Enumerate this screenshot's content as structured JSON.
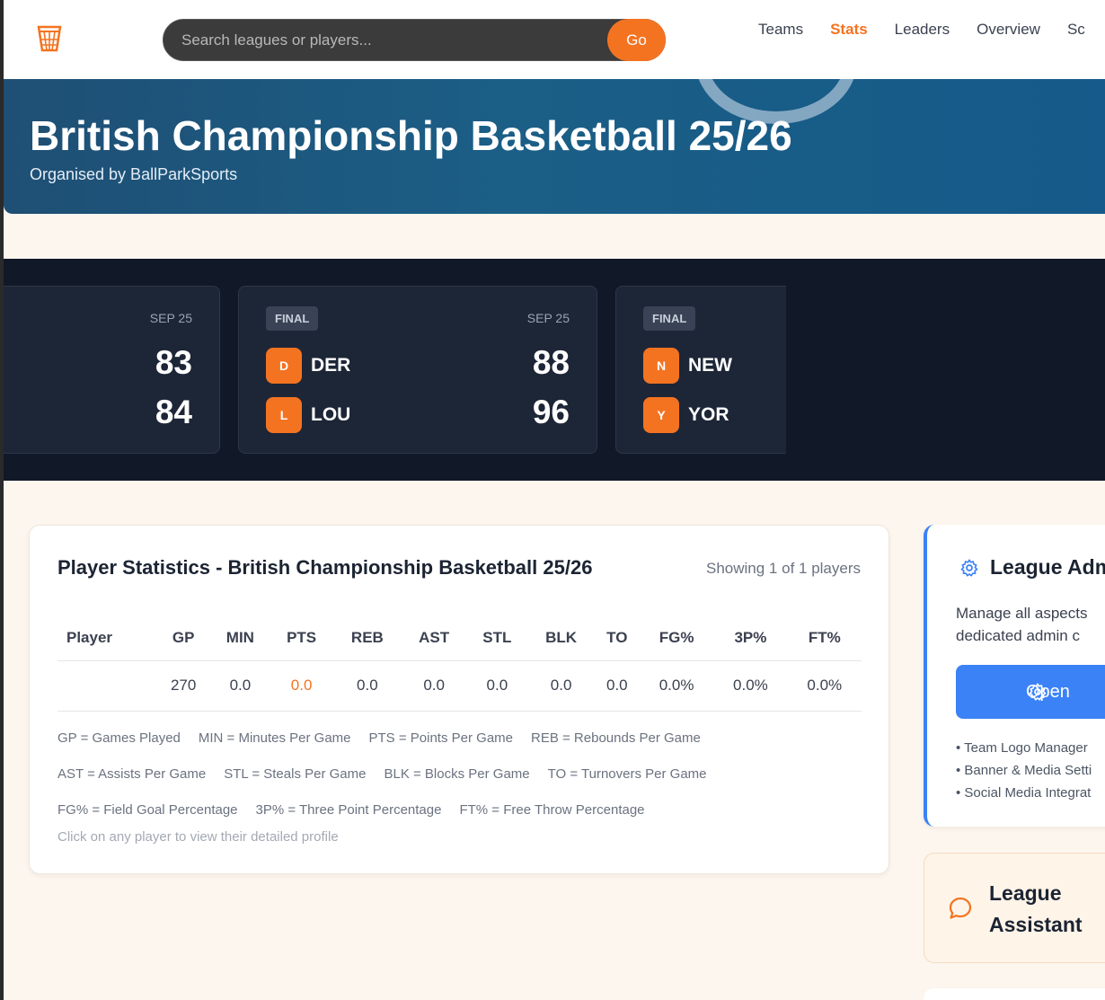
{
  "header": {
    "search_placeholder": "Search leagues or players...",
    "go_label": "Go",
    "nav": [
      {
        "label": "Teams",
        "active": false
      },
      {
        "label": "Stats",
        "active": true
      },
      {
        "label": "Leaders",
        "active": false
      },
      {
        "label": "Overview",
        "active": false
      },
      {
        "label": "Sc",
        "active": false
      }
    ]
  },
  "banner": {
    "title": "British Championship Basketball 25/26",
    "organiser": "Organised by BallParkSports"
  },
  "scores": [
    {
      "status": "",
      "date": "SEP 25",
      "home": {
        "initial": "",
        "abbr": "",
        "score": "83"
      },
      "away": {
        "initial": "",
        "abbr": "",
        "score": "84"
      }
    },
    {
      "status": "FINAL",
      "date": "SEP 25",
      "home": {
        "initial": "D",
        "abbr": "DER",
        "score": "88"
      },
      "away": {
        "initial": "L",
        "abbr": "LOU",
        "score": "96"
      }
    },
    {
      "status": "FINAL",
      "date": "",
      "home": {
        "initial": "N",
        "abbr": "NEW",
        "score": ""
      },
      "away": {
        "initial": "Y",
        "abbr": "YOR",
        "score": ""
      }
    }
  ],
  "stats": {
    "title": "Player Statistics - British Championship Basketball 25/26",
    "count": "Showing 1 of 1 players",
    "columns": [
      "Player",
      "GP",
      "MIN",
      "PTS",
      "REB",
      "AST",
      "STL",
      "BLK",
      "TO",
      "FG%",
      "3P%",
      "FT%"
    ],
    "rows": [
      [
        "",
        "270",
        "0.0",
        "0.0",
        "0.0",
        "0.0",
        "0.0",
        "0.0",
        "0.0",
        "0.0%",
        "0.0%",
        "0.0%"
      ]
    ],
    "legend": [
      [
        "GP = Games Played",
        "MIN = Minutes Per Game",
        "PTS = Points Per Game",
        "REB = Rebounds Per Game"
      ],
      [
        "AST = Assists Per Game",
        "STL = Steals Per Game",
        "BLK = Blocks Per Game",
        "TO = Turnovers Per Game"
      ],
      [
        "FG% = Field Goal Percentage",
        "3P% = Three Point Percentage",
        "FT% = Free Throw Percentage"
      ]
    ],
    "hint": "Click on any player to view their detailed profile"
  },
  "admin": {
    "title": "League Adm",
    "desc_line1": "Manage all aspects",
    "desc_line2": "dedicated admin c",
    "button": "Open",
    "items": [
      "• Team Logo Manager",
      "• Banner & Media Setti",
      "• Social Media Integrat"
    ]
  },
  "assistant": {
    "title_line1": "League",
    "title_line2": "Assistant"
  },
  "colors": {
    "accent": "#f47321",
    "admin_blue": "#3b82f6",
    "scores_bg": "#111827"
  }
}
